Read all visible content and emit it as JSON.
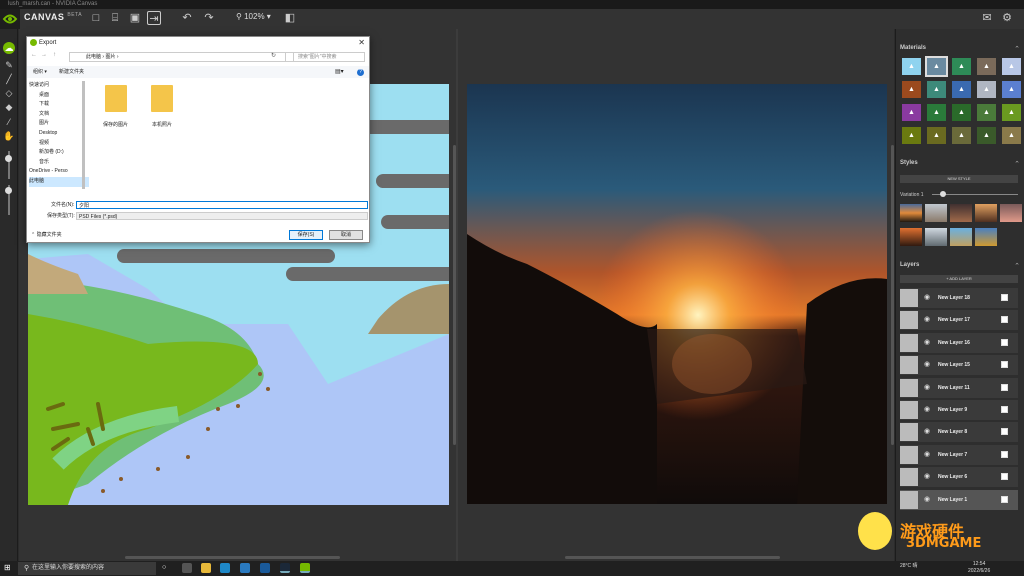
{
  "window": {
    "title": "lush_marsh.can - NVIDIA Canvas"
  },
  "app": {
    "name": "CANVAS",
    "badge": "BETA",
    "zoom": "102%"
  },
  "colors": {
    "accent": "#76b900",
    "panel": "#2e2e2e"
  },
  "toolbar": {
    "icons": [
      "new-file-icon",
      "open-folder-icon",
      "save-icon",
      "export-icon",
      "undo-icon",
      "redo-icon",
      "zoom-icon",
      "layout-icon"
    ]
  },
  "right_panel": {
    "materials_title": "Materials",
    "materials": [
      {
        "icon": "cloud-icon",
        "color": "#8fd3ef"
      },
      {
        "icon": "cloud2-icon",
        "color": "#6a8aa0"
      },
      {
        "icon": "grass-icon",
        "color": "#2e8b57"
      },
      {
        "icon": "mountain-icon",
        "color": "#7a6a5a"
      },
      {
        "icon": "fog-icon",
        "color": "#b8c7e6"
      },
      {
        "icon": "dirt-icon",
        "color": "#9b4a1e"
      },
      {
        "icon": "house-icon",
        "color": "#3d8a7a"
      },
      {
        "icon": "snow-icon",
        "color": "#3a6ab0"
      },
      {
        "icon": "sand-icon",
        "color": "#b0b6c2"
      },
      {
        "icon": "water-icon",
        "color": "#5b7fd0"
      },
      {
        "icon": "flower-icon",
        "color": "#8a3aa0"
      },
      {
        "icon": "plant-icon",
        "color": "#2a7a3a"
      },
      {
        "icon": "rock-icon",
        "color": "#2a6a2a"
      },
      {
        "icon": "hill-icon",
        "color": "#4a7a3a"
      },
      {
        "icon": "tree-icon",
        "color": "#6a9a20"
      },
      {
        "icon": "bush-icon",
        "color": "#6a7a10"
      },
      {
        "icon": "stone-icon",
        "color": "#6a6a20"
      },
      {
        "icon": "beach-icon",
        "color": "#6a6a3a"
      },
      {
        "icon": "field-icon",
        "color": "#3a5a2a"
      },
      {
        "icon": "wheat-icon",
        "color": "#8a7a4a"
      }
    ],
    "styles_title": "Styles",
    "new_style": "NEW STYLE",
    "variation_label": "Variation 1",
    "layers_title": "Layers",
    "add_layer": "+ ADD LAYER",
    "layers": [
      "New Layer 18",
      "New Layer 17",
      "New Layer 16",
      "New Layer 15",
      "New Layer 11",
      "New Layer 9",
      "New Layer 8",
      "New Layer 7",
      "New Layer 6",
      "New Layer 1"
    ]
  },
  "dialog": {
    "title": "Export",
    "path": [
      "此电脑",
      "图片"
    ],
    "search_placeholder": "搜索\"图片\"中搜索",
    "organize": "组织 ▾",
    "new_folder": "新建文件夹",
    "nav": [
      "快速访问",
      "桌面",
      "下载",
      "文档",
      "图片",
      "Desktop",
      "视频",
      "新加卷 (D:)",
      "音乐",
      "OneDrive - Perso",
      "此电脑"
    ],
    "folders": [
      "保存的图片",
      "本机照片"
    ],
    "filename_label": "文件名(N):",
    "filename_value": "夕阳",
    "filetype_label": "保存类型(T):",
    "filetype_value": "PSD Files (*.psd)",
    "hide_folders": "隐藏文件夹",
    "save": "保存(S)",
    "cancel": "取消"
  },
  "taskbar": {
    "search": "在这里输入你要搜索的内容",
    "weather": "28°C 晴",
    "time": "12:54",
    "date": "2022/6/26"
  },
  "watermark": {
    "cn": "游戏硬件",
    "en": "3DMGAME"
  }
}
